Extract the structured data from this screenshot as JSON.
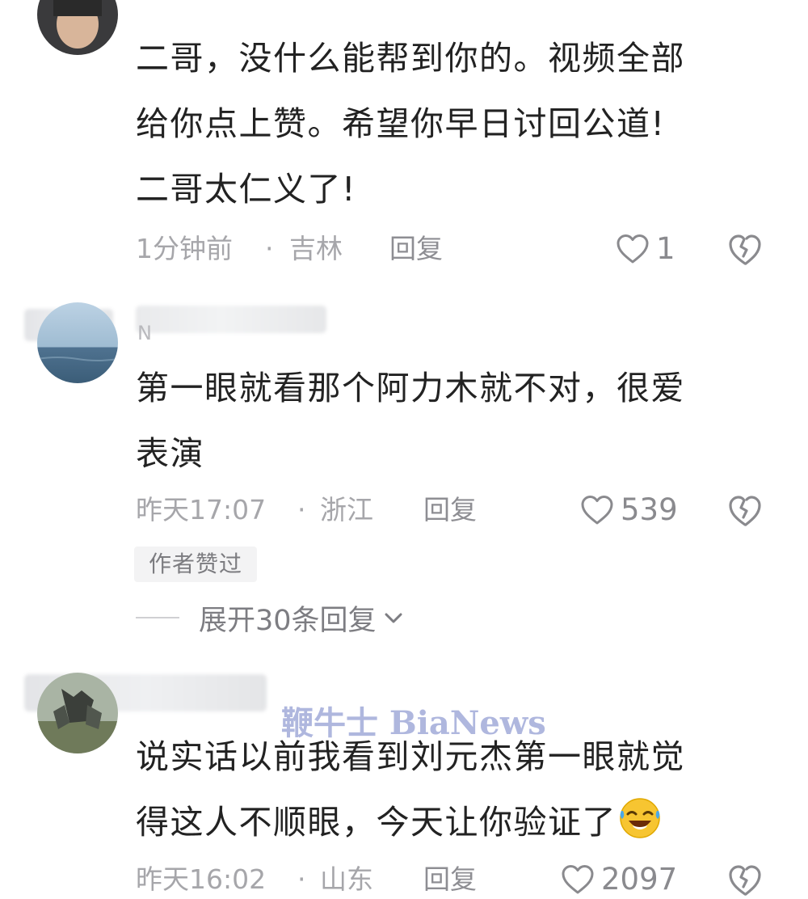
{
  "comments": [
    {
      "body_lines": [
        "二哥，没什么能帮到你的。视频全部",
        "给你点上赞。希望你早日讨回公道!",
        "二哥太仁义了!"
      ],
      "time": "1分钟前",
      "separator": "·",
      "region": "吉林",
      "reply_label": "回复",
      "likes": "1"
    },
    {
      "name_peek": "N",
      "body_lines": [
        "第一眼就看那个阿力木就不对，很爱",
        "表演"
      ],
      "time": "昨天17:07",
      "separator": "·",
      "region": "浙江",
      "reply_label": "回复",
      "likes": "539",
      "badge": "作者赞过",
      "expand_label": "展开30条回复"
    },
    {
      "body_lines": [
        "说实话以前我看到刘元杰第一眼就觉",
        "得这人不顺眼，今天让你验证了"
      ],
      "time": "昨天16:02",
      "separator": "·",
      "region": "山东",
      "reply_label": "回复",
      "likes": "2097",
      "emoji": "laughing-crying-emoji"
    }
  ],
  "watermark": "鞭牛士 BiaNews",
  "colors": {
    "text": "#222222",
    "meta": "#a6a6aa",
    "icon": "#8a8a8e",
    "watermark": "#a9b1dc"
  }
}
